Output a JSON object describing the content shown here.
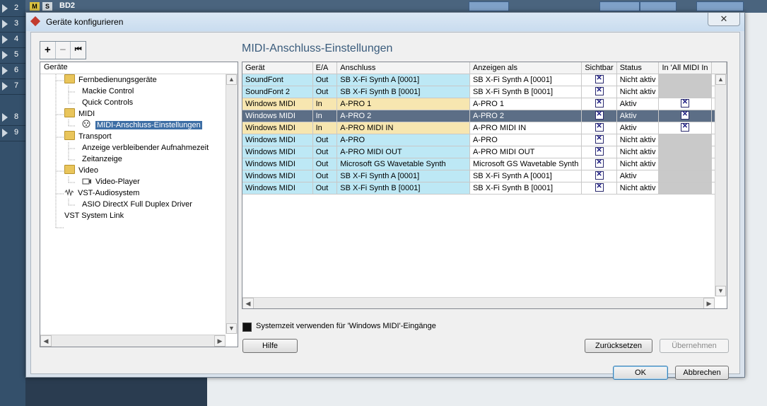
{
  "background": {
    "tracks": [
      "2",
      "3",
      "4",
      "5",
      "6",
      "7",
      "8",
      "9"
    ],
    "top_track_label": "BD2",
    "mute_label": "M",
    "solo_label": "S"
  },
  "dialog": {
    "title": "Geräte konfigurieren",
    "close_glyph": "✕",
    "toolbar": {
      "add": "+",
      "remove": "−",
      "reset": "⏮"
    },
    "heading": "MIDI-Anschluss-Einstellungen",
    "tree": {
      "header": "Geräte",
      "items": [
        {
          "label": "Fernbedienungsgeräte",
          "icon": "folder-icon"
        },
        {
          "label": "Mackie Control",
          "icon": ""
        },
        {
          "label": "Quick Controls",
          "icon": ""
        },
        {
          "label": "MIDI",
          "icon": "folder-icon"
        },
        {
          "label": "MIDI-Anschluss-Einstellungen",
          "icon": "midi-port-icon",
          "selected": true
        },
        {
          "label": "Transport",
          "icon": "folder-icon"
        },
        {
          "label": "Anzeige verbleibender Aufnahmezeit",
          "icon": ""
        },
        {
          "label": "Zeitanzeige",
          "icon": ""
        },
        {
          "label": "Video",
          "icon": "folder-icon"
        },
        {
          "label": "Video-Player",
          "icon": "video-player-icon"
        },
        {
          "label": "VST-Audiosystem",
          "icon": "audio-system-icon"
        },
        {
          "label": "ASIO DirectX Full Duplex Driver",
          "icon": ""
        },
        {
          "label": "VST System Link",
          "icon": ""
        }
      ]
    },
    "table": {
      "columns": [
        "Gerät",
        "E/A",
        "Anschluss",
        "Anzeigen als",
        "Sichtbar",
        "Status",
        "In 'All MIDI In"
      ],
      "rows": [
        {
          "device": "SoundFont",
          "io": "Out",
          "port": "SB X-Fi Synth A [0001]",
          "display": "SB X-Fi Synth A [0001]",
          "visible": true,
          "status": "Nicht aktiv",
          "all_midi": null
        },
        {
          "device": "SoundFont 2",
          "io": "Out",
          "port": "SB X-Fi Synth B [0001]",
          "display": "SB X-Fi Synth B [0001]",
          "visible": true,
          "status": "Nicht aktiv",
          "all_midi": null
        },
        {
          "device": "Windows MIDI",
          "io": "In",
          "port": "A-PRO 1",
          "display": "A-PRO 1",
          "visible": true,
          "status": "Aktiv",
          "all_midi": true
        },
        {
          "device": "Windows MIDI",
          "io": "In",
          "port": "A-PRO 2",
          "display": "A-PRO 2",
          "visible": true,
          "status": "Aktiv",
          "all_midi": true,
          "selected": true
        },
        {
          "device": "Windows MIDI",
          "io": "In",
          "port": "A-PRO MIDI IN",
          "display": "A-PRO MIDI IN",
          "visible": true,
          "status": "Aktiv",
          "all_midi": true
        },
        {
          "device": "Windows MIDI",
          "io": "Out",
          "port": "A-PRO",
          "display": "A-PRO",
          "visible": true,
          "status": "Nicht aktiv",
          "all_midi": null
        },
        {
          "device": "Windows MIDI",
          "io": "Out",
          "port": "A-PRO MIDI OUT",
          "display": "A-PRO MIDI OUT",
          "visible": true,
          "status": "Nicht aktiv",
          "all_midi": null
        },
        {
          "device": "Windows MIDI",
          "io": "Out",
          "port": "Microsoft GS Wavetable Synth",
          "display": "Microsoft GS Wavetable Synth",
          "visible": true,
          "status": "Nicht aktiv",
          "all_midi": null
        },
        {
          "device": "Windows MIDI",
          "io": "Out",
          "port": "SB X-Fi Synth A [0001]",
          "display": "SB X-Fi Synth A [0001]",
          "visible": true,
          "status": "Aktiv",
          "all_midi": null
        },
        {
          "device": "Windows MIDI",
          "io": "Out",
          "port": "SB X-Fi Synth B [0001]",
          "display": "SB X-Fi Synth B [0001]",
          "visible": true,
          "status": "Nicht aktiv",
          "all_midi": null
        }
      ]
    },
    "system_time_label": "Systemzeit verwenden für 'Windows MIDI'-Eingänge",
    "buttons": {
      "help": "Hilfe",
      "reset": "Zurücksetzen",
      "apply": "Übernehmen",
      "ok": "OK",
      "cancel": "Abbrechen"
    },
    "colors": {
      "soundfont_row": "#bde8f5",
      "windows_midi_in_row": "#f7e6b0",
      "selected_row": "#5c6e86",
      "heading": "#3a5c7c"
    }
  }
}
